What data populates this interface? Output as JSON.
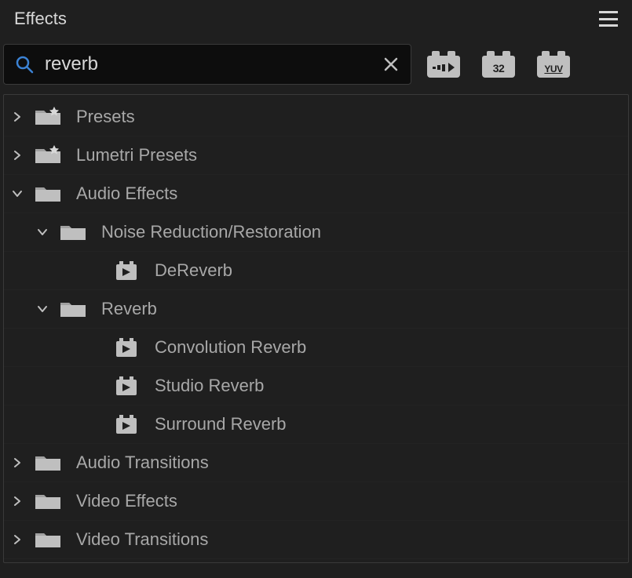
{
  "panel": {
    "title": "Effects"
  },
  "search": {
    "value": "reverb",
    "placeholder": ""
  },
  "toolbar": {
    "accel_label": "",
    "bit32_label": "32",
    "yuv_label": "YUV"
  },
  "tree": [
    {
      "label": "Presets",
      "icon": "preset-folder",
      "expanded": false,
      "depth": 0,
      "hasChildren": true
    },
    {
      "label": "Lumetri Presets",
      "icon": "preset-folder",
      "expanded": false,
      "depth": 0,
      "hasChildren": true
    },
    {
      "label": "Audio Effects",
      "icon": "folder",
      "expanded": true,
      "depth": 0,
      "hasChildren": true
    },
    {
      "label": "Noise Reduction/Restoration",
      "icon": "folder",
      "expanded": true,
      "depth": 1,
      "hasChildren": true
    },
    {
      "label": "DeReverb",
      "icon": "effect",
      "expanded": false,
      "depth": 2,
      "hasChildren": false
    },
    {
      "label": "Reverb",
      "icon": "folder",
      "expanded": true,
      "depth": 1,
      "hasChildren": true
    },
    {
      "label": "Convolution Reverb",
      "icon": "effect",
      "expanded": false,
      "depth": 2,
      "hasChildren": false
    },
    {
      "label": "Studio Reverb",
      "icon": "effect",
      "expanded": false,
      "depth": 2,
      "hasChildren": false
    },
    {
      "label": "Surround Reverb",
      "icon": "effect",
      "expanded": false,
      "depth": 2,
      "hasChildren": false
    },
    {
      "label": "Audio Transitions",
      "icon": "folder",
      "expanded": false,
      "depth": 0,
      "hasChildren": true
    },
    {
      "label": "Video Effects",
      "icon": "folder",
      "expanded": false,
      "depth": 0,
      "hasChildren": true
    },
    {
      "label": "Video Transitions",
      "icon": "folder",
      "expanded": false,
      "depth": 0,
      "hasChildren": true
    }
  ]
}
